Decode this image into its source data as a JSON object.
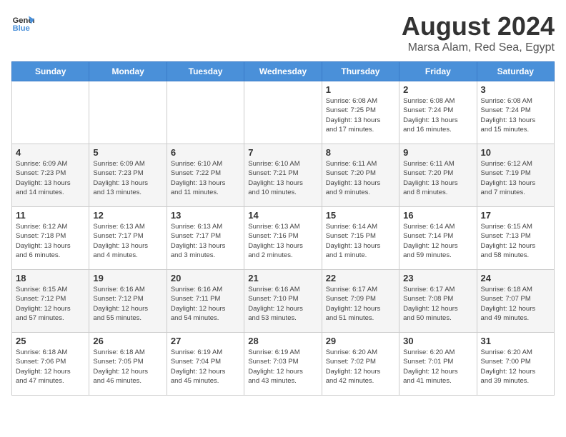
{
  "header": {
    "logo_general": "General",
    "logo_blue": "Blue",
    "title": "August 2024",
    "subtitle": "Marsa Alam, Red Sea, Egypt"
  },
  "weekdays": [
    "Sunday",
    "Monday",
    "Tuesday",
    "Wednesday",
    "Thursday",
    "Friday",
    "Saturday"
  ],
  "weeks": [
    [
      {
        "day": "",
        "info": ""
      },
      {
        "day": "",
        "info": ""
      },
      {
        "day": "",
        "info": ""
      },
      {
        "day": "",
        "info": ""
      },
      {
        "day": "1",
        "info": "Sunrise: 6:08 AM\nSunset: 7:25 PM\nDaylight: 13 hours\nand 17 minutes."
      },
      {
        "day": "2",
        "info": "Sunrise: 6:08 AM\nSunset: 7:24 PM\nDaylight: 13 hours\nand 16 minutes."
      },
      {
        "day": "3",
        "info": "Sunrise: 6:08 AM\nSunset: 7:24 PM\nDaylight: 13 hours\nand 15 minutes."
      }
    ],
    [
      {
        "day": "4",
        "info": "Sunrise: 6:09 AM\nSunset: 7:23 PM\nDaylight: 13 hours\nand 14 minutes."
      },
      {
        "day": "5",
        "info": "Sunrise: 6:09 AM\nSunset: 7:23 PM\nDaylight: 13 hours\nand 13 minutes."
      },
      {
        "day": "6",
        "info": "Sunrise: 6:10 AM\nSunset: 7:22 PM\nDaylight: 13 hours\nand 11 minutes."
      },
      {
        "day": "7",
        "info": "Sunrise: 6:10 AM\nSunset: 7:21 PM\nDaylight: 13 hours\nand 10 minutes."
      },
      {
        "day": "8",
        "info": "Sunrise: 6:11 AM\nSunset: 7:20 PM\nDaylight: 13 hours\nand 9 minutes."
      },
      {
        "day": "9",
        "info": "Sunrise: 6:11 AM\nSunset: 7:20 PM\nDaylight: 13 hours\nand 8 minutes."
      },
      {
        "day": "10",
        "info": "Sunrise: 6:12 AM\nSunset: 7:19 PM\nDaylight: 13 hours\nand 7 minutes."
      }
    ],
    [
      {
        "day": "11",
        "info": "Sunrise: 6:12 AM\nSunset: 7:18 PM\nDaylight: 13 hours\nand 6 minutes."
      },
      {
        "day": "12",
        "info": "Sunrise: 6:13 AM\nSunset: 7:17 PM\nDaylight: 13 hours\nand 4 minutes."
      },
      {
        "day": "13",
        "info": "Sunrise: 6:13 AM\nSunset: 7:17 PM\nDaylight: 13 hours\nand 3 minutes."
      },
      {
        "day": "14",
        "info": "Sunrise: 6:13 AM\nSunset: 7:16 PM\nDaylight: 13 hours\nand 2 minutes."
      },
      {
        "day": "15",
        "info": "Sunrise: 6:14 AM\nSunset: 7:15 PM\nDaylight: 13 hours\nand 1 minute."
      },
      {
        "day": "16",
        "info": "Sunrise: 6:14 AM\nSunset: 7:14 PM\nDaylight: 12 hours\nand 59 minutes."
      },
      {
        "day": "17",
        "info": "Sunrise: 6:15 AM\nSunset: 7:13 PM\nDaylight: 12 hours\nand 58 minutes."
      }
    ],
    [
      {
        "day": "18",
        "info": "Sunrise: 6:15 AM\nSunset: 7:12 PM\nDaylight: 12 hours\nand 57 minutes."
      },
      {
        "day": "19",
        "info": "Sunrise: 6:16 AM\nSunset: 7:12 PM\nDaylight: 12 hours\nand 55 minutes."
      },
      {
        "day": "20",
        "info": "Sunrise: 6:16 AM\nSunset: 7:11 PM\nDaylight: 12 hours\nand 54 minutes."
      },
      {
        "day": "21",
        "info": "Sunrise: 6:16 AM\nSunset: 7:10 PM\nDaylight: 12 hours\nand 53 minutes."
      },
      {
        "day": "22",
        "info": "Sunrise: 6:17 AM\nSunset: 7:09 PM\nDaylight: 12 hours\nand 51 minutes."
      },
      {
        "day": "23",
        "info": "Sunrise: 6:17 AM\nSunset: 7:08 PM\nDaylight: 12 hours\nand 50 minutes."
      },
      {
        "day": "24",
        "info": "Sunrise: 6:18 AM\nSunset: 7:07 PM\nDaylight: 12 hours\nand 49 minutes."
      }
    ],
    [
      {
        "day": "25",
        "info": "Sunrise: 6:18 AM\nSunset: 7:06 PM\nDaylight: 12 hours\nand 47 minutes."
      },
      {
        "day": "26",
        "info": "Sunrise: 6:18 AM\nSunset: 7:05 PM\nDaylight: 12 hours\nand 46 minutes."
      },
      {
        "day": "27",
        "info": "Sunrise: 6:19 AM\nSunset: 7:04 PM\nDaylight: 12 hours\nand 45 minutes."
      },
      {
        "day": "28",
        "info": "Sunrise: 6:19 AM\nSunset: 7:03 PM\nDaylight: 12 hours\nand 43 minutes."
      },
      {
        "day": "29",
        "info": "Sunrise: 6:20 AM\nSunset: 7:02 PM\nDaylight: 12 hours\nand 42 minutes."
      },
      {
        "day": "30",
        "info": "Sunrise: 6:20 AM\nSunset: 7:01 PM\nDaylight: 12 hours\nand 41 minutes."
      },
      {
        "day": "31",
        "info": "Sunrise: 6:20 AM\nSunset: 7:00 PM\nDaylight: 12 hours\nand 39 minutes."
      }
    ]
  ]
}
